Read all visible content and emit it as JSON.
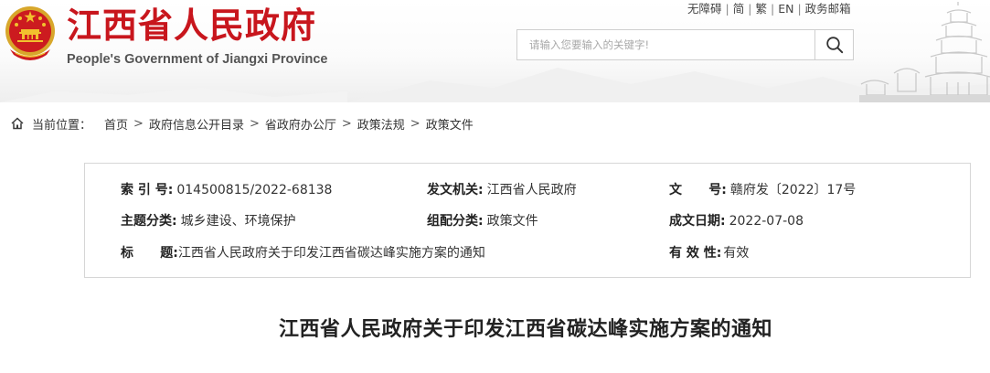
{
  "header": {
    "title": "江西省人民政府",
    "subtitle": "People's Government of Jiangxi Province",
    "top_links": [
      "无障碍",
      "简",
      "繁",
      "EN",
      "政务邮箱"
    ],
    "search": {
      "placeholder": "请输入您要输入的关键字!",
      "value": ""
    },
    "brand_color": "#c8161d",
    "emblem_icon": "national-emblem-icon",
    "search_icon": "magnifier-icon"
  },
  "breadcrumb": {
    "label": "当前位置：",
    "items": [
      "首页",
      "政府信息公开目录",
      "省政府办公厅",
      "政策法规",
      "政策文件"
    ],
    "separator": ">"
  },
  "info": {
    "index_no": {
      "label": "索 引 号:",
      "value": "014500815/2022-68138"
    },
    "issuer": {
      "label": "发文机关:",
      "value": "江西省人民政府"
    },
    "doc_no": {
      "label": "文      号:",
      "value": "赣府发〔2022〕17号"
    },
    "topic": {
      "label": "主题分类:",
      "value": "城乡建设、环境保护"
    },
    "category": {
      "label": "组配分类:",
      "value": "政策文件"
    },
    "date": {
      "label": "成文日期:",
      "value": "2022-07-08"
    },
    "title": {
      "label": "标      题:",
      "value": "江西省人民政府关于印发江西省碳达峰实施方案的通知"
    },
    "validity": {
      "label": "有 效 性:",
      "value": "有效"
    }
  },
  "article": {
    "title": "江西省人民政府关于印发江西省碳达峰实施方案的通知"
  }
}
